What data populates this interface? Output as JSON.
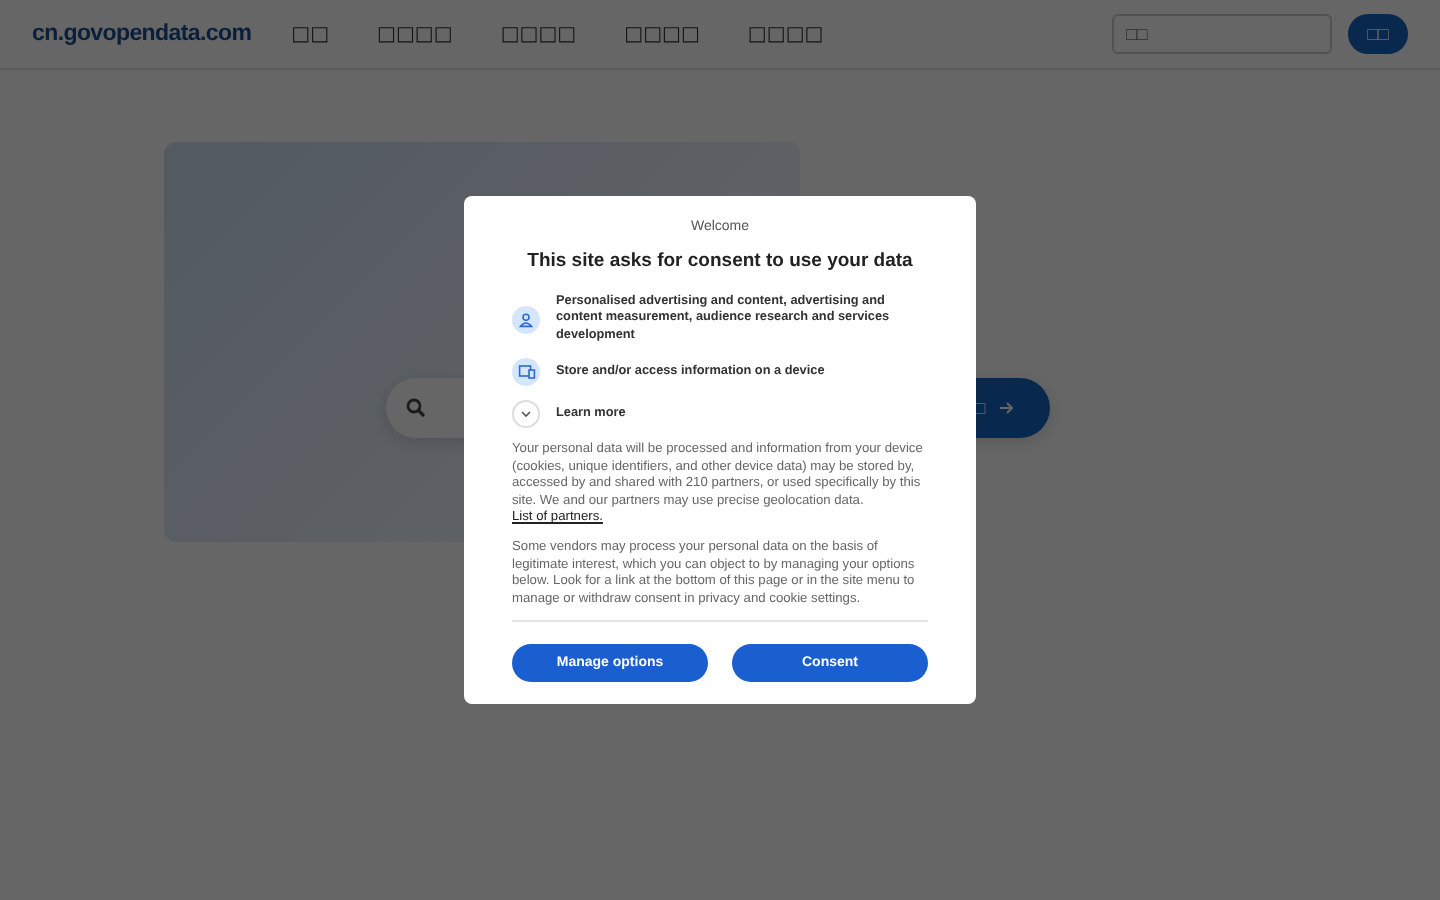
{
  "header": {
    "logo": "cn.govopendata.com",
    "nav": [
      "□□",
      "□□□□",
      "□□□□",
      "□□□□",
      "□□□□"
    ],
    "search": {
      "placeholder": "□□"
    },
    "search_button": "□□"
  },
  "hero": {
    "search_button": "□"
  },
  "consent_dialog": {
    "eyebrow": "Welcome",
    "title": "This site asks for consent to use your data",
    "purposes": [
      {
        "kind": "person",
        "text": "Personalised advertising and content, advertising and content measurement, audience research and services development"
      },
      {
        "kind": "device",
        "text": "Store and/or access information on a device"
      },
      {
        "kind": "expand",
        "text": "Learn more"
      }
    ],
    "paragraphs": [
      "Your personal data will be processed and information from your device (cookies, unique identifiers, and other device data) may be stored by, accessed by and shared with 210 partners, or used specifically by this site. We and our partners may use precise geolocation data.",
      "Some vendors may process your personal data on the basis of legitimate interest, which you can object to by managing your options below. Look for a link at the bottom of this page or in the site menu to manage or withdraw consent in privacy and cookie settings."
    ],
    "partners_link": "List of partners.",
    "buttons": [
      "Manage options",
      "Consent"
    ]
  }
}
